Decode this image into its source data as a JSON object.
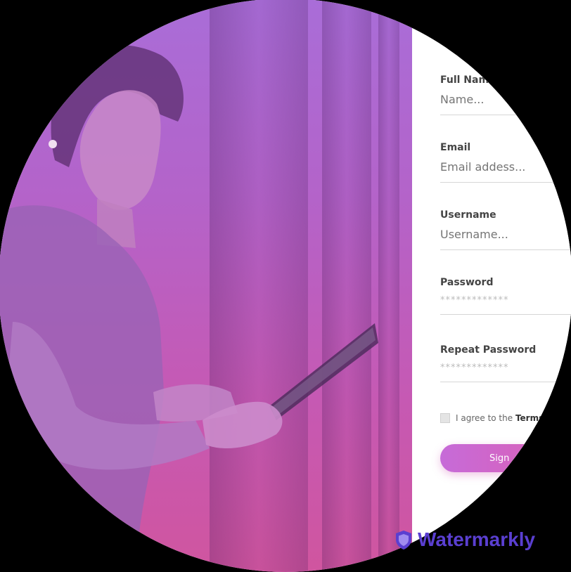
{
  "form": {
    "fields": [
      {
        "label": "Full Name",
        "placeholder": "Name..."
      },
      {
        "label": "Email",
        "placeholder": "Email addess..."
      },
      {
        "label": "Username",
        "placeholder": "Username..."
      },
      {
        "label": "Password",
        "value": "*************"
      },
      {
        "label": "Repeat Password",
        "value": "*************"
      }
    ],
    "agree_prefix": "I agree to the ",
    "agree_terms": "Terms",
    "signup_label": "Sign"
  },
  "watermark": {
    "text": "Watermarkly",
    "icon": "shield-icon",
    "color": "#5a3fd1"
  },
  "colors": {
    "gradient_top": "#a96dd8",
    "gradient_bottom": "#d0559f",
    "button_start": "#c66bd8",
    "button_end": "#e05db0"
  }
}
